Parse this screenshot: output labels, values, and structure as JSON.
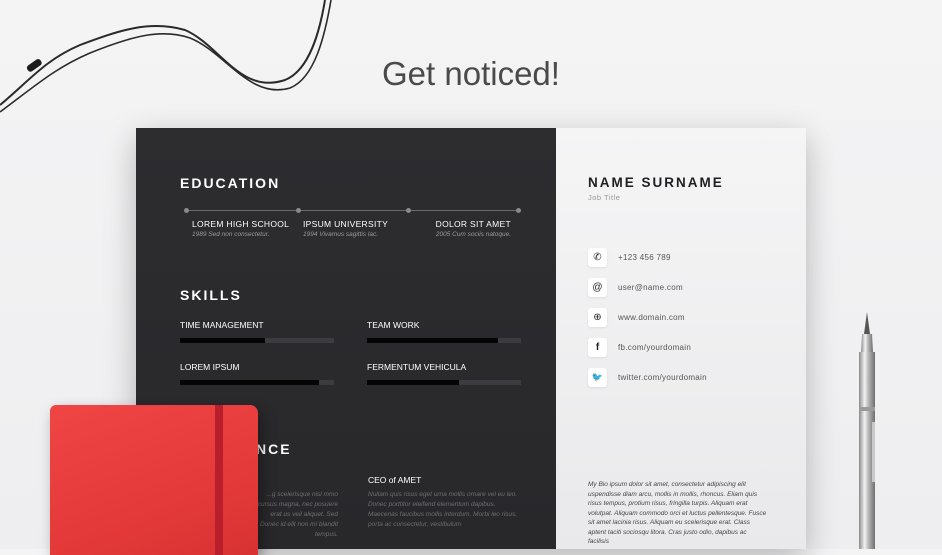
{
  "headline": "Get noticed!",
  "resume": {
    "education": {
      "title": "EDUCATION",
      "items": [
        {
          "school": "LOREM HIGH SCHOOL",
          "detail": "1989 Sed non consectetur."
        },
        {
          "school": "IPSUM UNIVERSITY",
          "detail": "1994 Vivamus sagittis lac."
        },
        {
          "school": "DOLOR SIT AMET",
          "detail": "2005 Cum sociis natoque."
        }
      ]
    },
    "skills": {
      "title": "SKILLS",
      "items": [
        {
          "label": "TIME MANAGEMENT",
          "level": 0.55
        },
        {
          "label": "TEAM WORK",
          "level": 0.85
        },
        {
          "label": "LOREM IPSUM",
          "level": 0.9
        },
        {
          "label": "FERMENTUM VEHICULA",
          "level": 0.6
        }
      ]
    },
    "experience": {
      "title_partial": "NCE",
      "role": "CEO of AMET",
      "text_left": "...g scelerisque nisl mmo cursus magna, nec posuere erat us veil aliquet. Sed Donec id elit non mi blandit tempus.",
      "text_right": "Nullam quis risus eget urna mollis ornare vel eu leo. Donec porttitor eleifend elementum dapibus. Maecenas faucibus mollis interdum. Morbi leo risus, porta ac consectetur, vestibulum"
    },
    "name": "NAME SURNAME",
    "job_title": "Job Title",
    "contacts": [
      {
        "icon": "phone-icon",
        "glyph": "✆",
        "text": "+123 456 789"
      },
      {
        "icon": "at-icon",
        "glyph": "@",
        "text": "user@name.com"
      },
      {
        "icon": "globe-icon",
        "glyph": "⊕",
        "text": "www.domain.com"
      },
      {
        "icon": "facebook-icon",
        "glyph": "f",
        "text": "fb.com/yourdomain"
      },
      {
        "icon": "twitter-icon",
        "glyph": "🐦",
        "text": "twitter.com/yourdomain"
      }
    ],
    "bio": "My Bio ipsum dolor sit amet, consectetur adipiscing elit uspendisse diam arcu, mollis in mollis, rhoncus. Eliam quis risus tempus, protium risus, fringilla turpis. Aliquam erat volutpat. Aliquam commodo orci et luctus pellentesque. Fusce sit amet lacinia risus. Aliquam eu scelerisque erat. Class aptent taciti sociosqu litora. Cras justo odio, dapibus ac facilisis"
  },
  "colors": {
    "dark_panel": "#2b2b2e",
    "light_panel": "#efeff0",
    "notebook": "#e8403e"
  }
}
